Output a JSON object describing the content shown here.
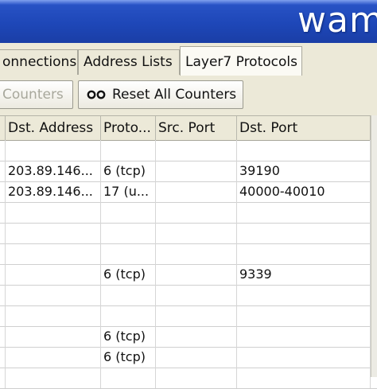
{
  "window": {
    "title": "wam"
  },
  "tabs": [
    {
      "label": "onnections"
    },
    {
      "label": "Address Lists"
    },
    {
      "label": "Layer7 Protocols"
    }
  ],
  "toolbar": {
    "reset_counters_label": "Counters",
    "reset_all_label": "Reset All Counters",
    "reset_all_icon": "reset-counters-icon"
  },
  "table": {
    "columns": [
      "Dst. Address",
      "Proto...",
      "Src. Port",
      "Dst. Port"
    ],
    "rows": [
      {
        "dst_address": "",
        "protocol": "",
        "src_port": "",
        "dst_port": ""
      },
      {
        "dst_address": "203.89.146...",
        "protocol": "6 (tcp)",
        "src_port": "",
        "dst_port": "39190"
      },
      {
        "dst_address": "203.89.146...",
        "protocol": "17 (u...",
        "src_port": "",
        "dst_port": "40000-40010"
      },
      {
        "dst_address": "",
        "protocol": "",
        "src_port": "",
        "dst_port": ""
      },
      {
        "dst_address": "",
        "protocol": "",
        "src_port": "",
        "dst_port": ""
      },
      {
        "dst_address": "",
        "protocol": "",
        "src_port": "",
        "dst_port": ""
      },
      {
        "dst_address": "",
        "protocol": "6 (tcp)",
        "src_port": "",
        "dst_port": "9339"
      },
      {
        "dst_address": "",
        "protocol": "",
        "src_port": "",
        "dst_port": ""
      },
      {
        "dst_address": "",
        "protocol": "",
        "src_port": "",
        "dst_port": ""
      },
      {
        "dst_address": "",
        "protocol": "6 (tcp)",
        "src_port": "",
        "dst_port": ""
      },
      {
        "dst_address": "",
        "protocol": "6 (tcp)",
        "src_port": "",
        "dst_port": ""
      },
      {
        "dst_address": "",
        "protocol": "",
        "src_port": "",
        "dst_port": ""
      }
    ]
  }
}
